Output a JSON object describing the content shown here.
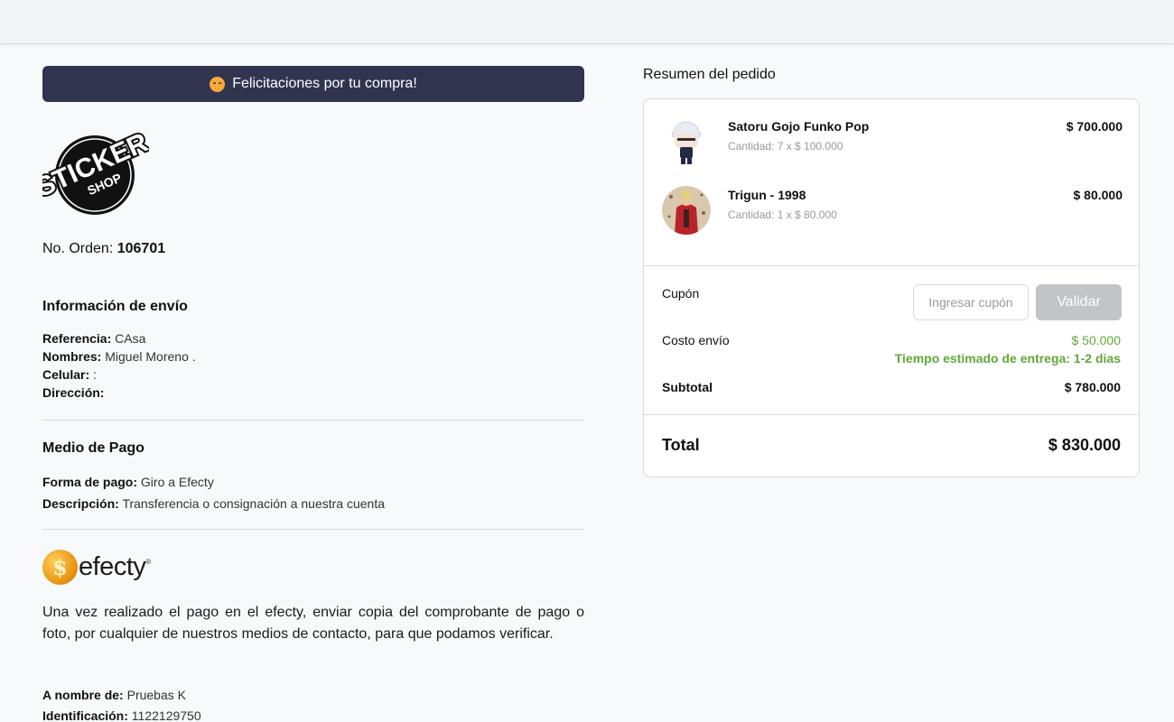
{
  "banner": {
    "text": "Felicitaciones por tu compra!",
    "icon": "hugging-face-emoji"
  },
  "logo": {
    "line1": "STICKER",
    "line2": "SHOP"
  },
  "order": {
    "label": "No. Orden:",
    "number": "106701"
  },
  "shipping": {
    "title": "Información de envío",
    "reference_label": "Referencia:",
    "reference_value": "CAsa",
    "names_label": "Nombres:",
    "names_value": "Miguel Moreno .",
    "phone_label": "Celular:",
    "phone_value": ":",
    "address_label": "Dirección:",
    "address_value": ""
  },
  "payment": {
    "title": "Medio de Pago",
    "method_label": "Forma de pago:",
    "method_value": "Giro a Efecty",
    "description_label": "Descripción:",
    "description_value": "Transferencia o consignación a nuestra cuenta"
  },
  "efecty": {
    "coin_symbol": "$",
    "brand": "efecty",
    "reg": "®"
  },
  "instructions": {
    "text": "Una vez realizado el pago en el efecty, enviar copia del comprobante de pago o foto, por cualquier de nuestros medios de contacto, para que podamos verificar.",
    "recipient_label": "A nombre de:",
    "recipient_value": "Pruebas K",
    "id_label": "Identificación:",
    "id_value": "1122129750"
  },
  "summary": {
    "title": "Resumen del pedido",
    "items": [
      {
        "name": "Satoru Gojo Funko Pop",
        "qty": "Cantidad: 7 x $ 100.000",
        "price": "$ 700.000"
      },
      {
        "name": "Trigun - 1998",
        "qty": "Cantidad: 1 x $ 80.000",
        "price": "$ 80.000"
      }
    ],
    "coupon_label": "Cupón",
    "coupon_placeholder": "Ingresar cupón",
    "coupon_button": "Validar",
    "shipping_label": "Costo envío",
    "shipping_cost": "$ 50.000",
    "delivery_estimate": "Tiempo estimado de entrega: 1-2 dias",
    "subtotal_label": "Subtotal",
    "subtotal_value": "$ 780.000",
    "total_label": "Total",
    "total_value": "$ 830.000"
  },
  "colors": {
    "banner_bg": "#31344f",
    "accent_green": "#62a83a",
    "button_disabled": "#c3c4c8"
  }
}
